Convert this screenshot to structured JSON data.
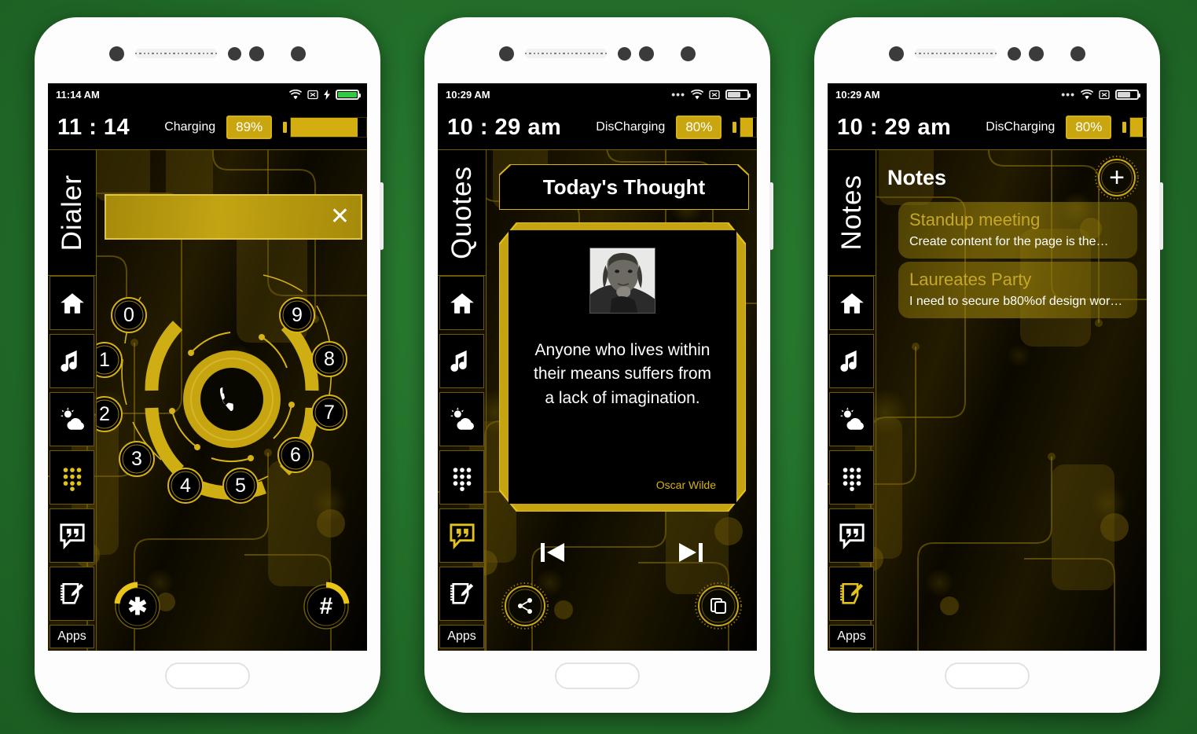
{
  "background_color": "#23702a",
  "theme": {
    "gold": "#d6b215",
    "gold_bright": "#e3c21c",
    "screen_bg": "#000000",
    "text": "#ffffff"
  },
  "phones": [
    {
      "id": "dialer",
      "statusbar": {
        "time": "11:14 AM",
        "icons": [
          "wifi-icon",
          "no-sim-icon",
          "charging-bolt-icon",
          "battery-icon"
        ],
        "battery_state": "charging-green"
      },
      "clockbar": {
        "clock": "11 : 14",
        "charge_label": "Charging",
        "percent": "89%",
        "battery_level": 89
      },
      "sidebar": {
        "title": "Dialer",
        "apps_label": "Apps",
        "active_icon": "dialpad-icon",
        "items": [
          {
            "icon": "home-icon",
            "label": "Home"
          },
          {
            "icon": "music-note-icon",
            "label": "Music"
          },
          {
            "icon": "weather-icon",
            "label": "Weather"
          },
          {
            "icon": "dialpad-icon",
            "label": "Dialer"
          },
          {
            "icon": "quotes-icon",
            "label": "Quotes"
          },
          {
            "icon": "notes-icon",
            "label": "Notes"
          }
        ]
      },
      "dialer": {
        "input_value": "",
        "clear_label": "✕",
        "digits": [
          "0",
          "1",
          "2",
          "3",
          "4",
          "5",
          "6",
          "7",
          "8",
          "9"
        ],
        "call_icon": "phone-handset-icon",
        "star_key": "✱",
        "hash_key": "#"
      }
    },
    {
      "id": "quotes",
      "statusbar": {
        "time": "10:29 AM",
        "icons": [
          "overflow-dots-icon",
          "wifi-icon",
          "no-sim-icon",
          "battery-icon"
        ],
        "battery_state": "discharging-grey"
      },
      "clockbar": {
        "clock": "10 : 29 am",
        "charge_label": "DisCharging",
        "percent": "80%",
        "battery_level": 80
      },
      "sidebar": {
        "title": "Quotes",
        "apps_label": "Apps",
        "active_icon": "quotes-icon",
        "items": [
          {
            "icon": "home-icon",
            "label": "Home"
          },
          {
            "icon": "music-note-icon",
            "label": "Music"
          },
          {
            "icon": "weather-icon",
            "label": "Weather"
          },
          {
            "icon": "dialpad-icon",
            "label": "Dialer"
          },
          {
            "icon": "quotes-icon",
            "label": "Quotes"
          },
          {
            "icon": "notes-icon",
            "label": "Notes"
          }
        ]
      },
      "quote": {
        "header": "Today's Thought",
        "portrait_alt": "Oscar Wilde portrait",
        "text": "Anyone who lives within their means suffers from a lack of imagination.",
        "author": "Oscar Wilde",
        "prev_icon": "skip-previous-icon",
        "next_icon": "skip-next-icon",
        "share_icon": "share-icon",
        "copy_icon": "copy-icon"
      }
    },
    {
      "id": "notes",
      "statusbar": {
        "time": "10:29 AM",
        "icons": [
          "overflow-dots-icon",
          "wifi-icon",
          "no-sim-icon",
          "battery-icon"
        ],
        "battery_state": "discharging-grey"
      },
      "clockbar": {
        "clock": "10 : 29 am",
        "charge_label": "DisCharging",
        "percent": "80%",
        "battery_level": 80
      },
      "sidebar": {
        "title": "Notes",
        "apps_label": "Apps",
        "active_icon": "notes-icon",
        "items": [
          {
            "icon": "home-icon",
            "label": "Home"
          },
          {
            "icon": "music-note-icon",
            "label": "Music"
          },
          {
            "icon": "weather-icon",
            "label": "Weather"
          },
          {
            "icon": "dialpad-icon",
            "label": "Dialer"
          },
          {
            "icon": "quotes-icon",
            "label": "Quotes"
          },
          {
            "icon": "notes-icon",
            "label": "Notes"
          }
        ]
      },
      "notes": {
        "title": "Notes",
        "add_label": "+",
        "items": [
          {
            "title": "Standup meeting",
            "preview": "Create content for the page is the…"
          },
          {
            "title": "Laureates Party",
            "preview": "I need to secure b80%of design wor…"
          }
        ]
      }
    }
  ]
}
